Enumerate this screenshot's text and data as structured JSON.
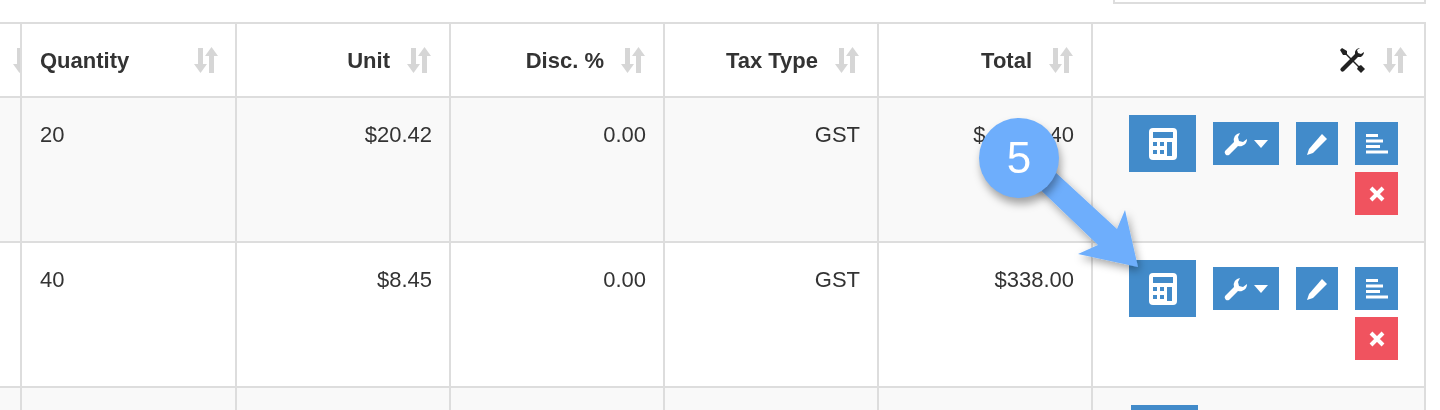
{
  "table": {
    "columns": [
      {
        "kind": "text",
        "label": "Quantity"
      },
      {
        "kind": "numeric",
        "label": "Unit"
      },
      {
        "kind": "numeric",
        "label": "Disc. %"
      },
      {
        "kind": "numeric",
        "label": "Tax Type"
      },
      {
        "kind": "numeric",
        "label": "Total"
      },
      {
        "kind": "tools"
      }
    ],
    "rows": [
      {
        "cells": [
          "20",
          "$20.42",
          "0.00",
          "GST",
          [
            "$",
            "40"
          ]
        ]
      },
      {
        "cells": [
          "40",
          "$8.45",
          "0.00",
          "GST",
          "$338.00"
        ]
      }
    ],
    "row_actions": [
      {
        "kind": "calculator"
      },
      {
        "kind": "wrench-dropdown"
      },
      {
        "kind": "edit"
      },
      {
        "kind": "details"
      },
      {
        "kind": "delete"
      }
    ]
  },
  "callout": {
    "number": "5"
  }
}
